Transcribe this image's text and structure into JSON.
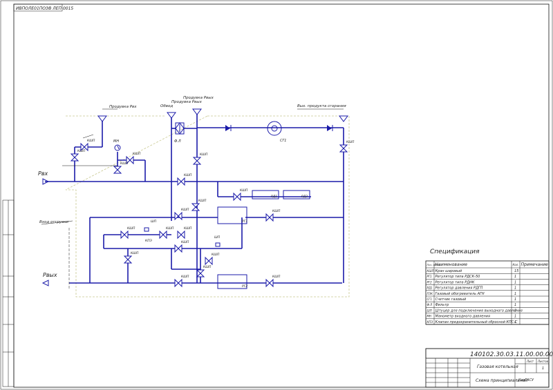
{
  "sheet_stamp": "ИВПОЛЕ01ПОЭВ ЛЕП 0015",
  "labels": {
    "p_in": "Рвх",
    "p_out": "Рвых",
    "purge_pin": "Продувка Рвх",
    "purge_pout": "Продувка Рвых",
    "purge_pout2": "Продувка Рвых",
    "bypass": "Обвод",
    "gas_outlet": "Вых. продукта сгорания",
    "odorant_in": "Вход отгрузки",
    "filter": "Ф.Л",
    "meter": "СГ1",
    "manometer": "МН",
    "pcv": "КПЭ",
    "shutoff": "ШП",
    "shutoff2": "ШП",
    "pr1": "РД1",
    "pr2": "РД2",
    "rg": "РГ1",
    "rg2": "РГ2",
    "kshch": "КШП"
  },
  "spec": {
    "title": "Спецификация",
    "headers": [
      "Поз. обозн.",
      "Наименование",
      "Кол.",
      "Примечание"
    ],
    "rows": [
      [
        "КШП",
        "Кран шаровый",
        "15",
        ""
      ],
      [
        "РГ1",
        "Регулятор типа РДСК-50",
        "1",
        ""
      ],
      [
        "РГ2",
        "Регулятор типа РДНК",
        "1",
        ""
      ],
      [
        "РД1",
        "Регулятор давления РДГП",
        "1",
        ""
      ],
      [
        "ПЗК",
        "Газовый обогреватель АГН",
        "1",
        ""
      ],
      [
        "СГ1",
        "Счетчик газовый",
        "1",
        ""
      ],
      [
        "Ф.Л",
        "Фильтр",
        "1",
        ""
      ],
      [
        "ШП",
        "Штуцер для подключения выходного давления",
        "2",
        ""
      ],
      [
        "МН",
        "Манометр входного давления",
        "1",
        ""
      ],
      [
        "КПЭ",
        "Клапан предохранительный сбросной КПС-С",
        "1",
        ""
      ]
    ]
  },
  "title_block": {
    "code": "140102.30.03.11.00.00.000",
    "name": "Газовая котельная",
    "doc": "Схема принципиальная",
    "sheet": "Лист",
    "sheets": "Листов",
    "sheets_n": "1",
    "org": "КазГАСУ"
  },
  "colors": {
    "pipe": "#1a1aa8",
    "line": "#111111",
    "zone": "#c8c890"
  }
}
